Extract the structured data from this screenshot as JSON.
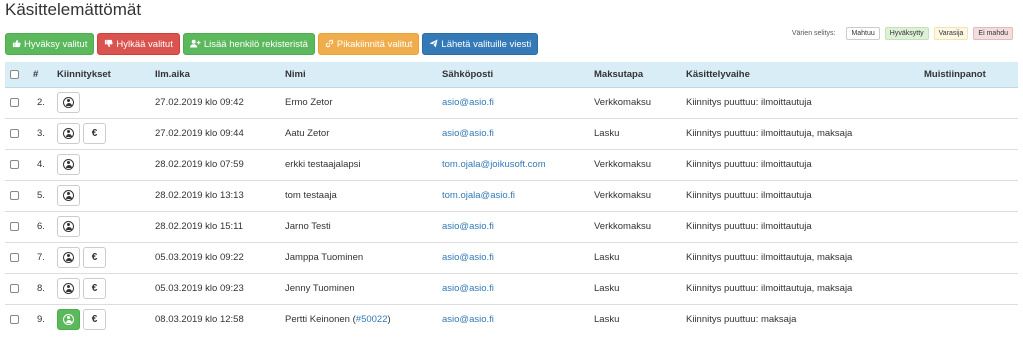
{
  "page": {
    "title": "Käsittelemättömät"
  },
  "toolbar": {
    "buttons": [
      {
        "label": "Hyväksy valitut",
        "icon": "thumbs-up-icon",
        "color": "#5cb85c"
      },
      {
        "label": "Hylkää valitut",
        "icon": "thumbs-down-icon",
        "color": "#d9534f"
      },
      {
        "label": "Lisää henkilö rekisteristä",
        "icon": "add-user-icon",
        "color": "#5cb85c"
      },
      {
        "label": "Pikakiinnitä valitut",
        "icon": "link-icon",
        "color": "#f0ad4e"
      },
      {
        "label": "Lähetä valituille viesti",
        "icon": "paper-plane-icon",
        "color": "#337ab7"
      }
    ]
  },
  "legend": {
    "label": "Värien selitys:",
    "items": [
      {
        "label": "Mahtuu",
        "color": "#ffffff"
      },
      {
        "label": "Hyväksytty",
        "color": "#dff0d8"
      },
      {
        "label": "Varasija",
        "color": "#fcf8e3"
      },
      {
        "label": "Ei mahdu",
        "color": "#f2dede"
      }
    ]
  },
  "table": {
    "headers": {
      "num": "#",
      "actions": "Kiinnitykset",
      "date": "Ilm.aika",
      "name": "Nimi",
      "email": "Sähköposti",
      "payment": "Maksutapa",
      "phase": "Käsittelyvaihe",
      "notes": "Muistiinpanot"
    },
    "rows": [
      {
        "num": "2.",
        "date": "27.02.2019 klo 09:42",
        "name": "Ermo Zetor",
        "id_link": "",
        "email": "asio@asio.fi",
        "payment": "Verkkomaksu",
        "phase": "Kiinnitys puuttuu: ilmoittautuja",
        "notes": "",
        "euro": false,
        "assigned": false
      },
      {
        "num": "3.",
        "date": "27.02.2019 klo 09:44",
        "name": "Aatu Zetor",
        "id_link": "",
        "email": "asio@asio.fi",
        "payment": "Lasku",
        "phase": "Kiinnitys puuttuu: ilmoittautuja, maksaja",
        "notes": "",
        "euro": true,
        "assigned": false
      },
      {
        "num": "4.",
        "date": "28.02.2019 klo 07:59",
        "name": "erkki testaajalapsi",
        "id_link": "",
        "email": "tom.ojala@joikusoft.com",
        "payment": "Verkkomaksu",
        "phase": "Kiinnitys puuttuu: ilmoittautuja",
        "notes": "",
        "euro": false,
        "assigned": false
      },
      {
        "num": "5.",
        "date": "28.02.2019 klo 13:13",
        "name": "tom testaaja",
        "id_link": "",
        "email": "tom.ojala@asio.fi",
        "payment": "Verkkomaksu",
        "phase": "Kiinnitys puuttuu: ilmoittautuja",
        "notes": "",
        "euro": false,
        "assigned": false
      },
      {
        "num": "6.",
        "date": "28.02.2019 klo 15:11",
        "name": "Jarno Testi",
        "id_link": "",
        "email": "asio@asio.fi",
        "payment": "Verkkomaksu",
        "phase": "Kiinnitys puuttuu: ilmoittautuja",
        "notes": "",
        "euro": false,
        "assigned": false
      },
      {
        "num": "7.",
        "date": "05.03.2019 klo 09:22",
        "name": "Jamppa Tuominen",
        "id_link": "",
        "email": "asio@asio.fi",
        "payment": "Lasku",
        "phase": "Kiinnitys puuttuu: ilmoittautuja, maksaja",
        "notes": "",
        "euro": true,
        "assigned": false
      },
      {
        "num": "8.",
        "date": "05.03.2019 klo 09:23",
        "name": "Jenny Tuominen",
        "id_link": "",
        "email": "asio@asio.fi",
        "payment": "Lasku",
        "phase": "Kiinnitys puuttuu: ilmoittautuja, maksaja",
        "notes": "",
        "euro": true,
        "assigned": false
      },
      {
        "num": "9.",
        "date": "08.03.2019 klo 12:58",
        "name": "Pertti Keinonen",
        "id_link": "#50022",
        "email": "asio@asio.fi",
        "payment": "Lasku",
        "phase": "Kiinnitys puuttuu: maksaja",
        "notes": "",
        "euro": true,
        "assigned": true
      }
    ],
    "euro_symbol": "€"
  }
}
